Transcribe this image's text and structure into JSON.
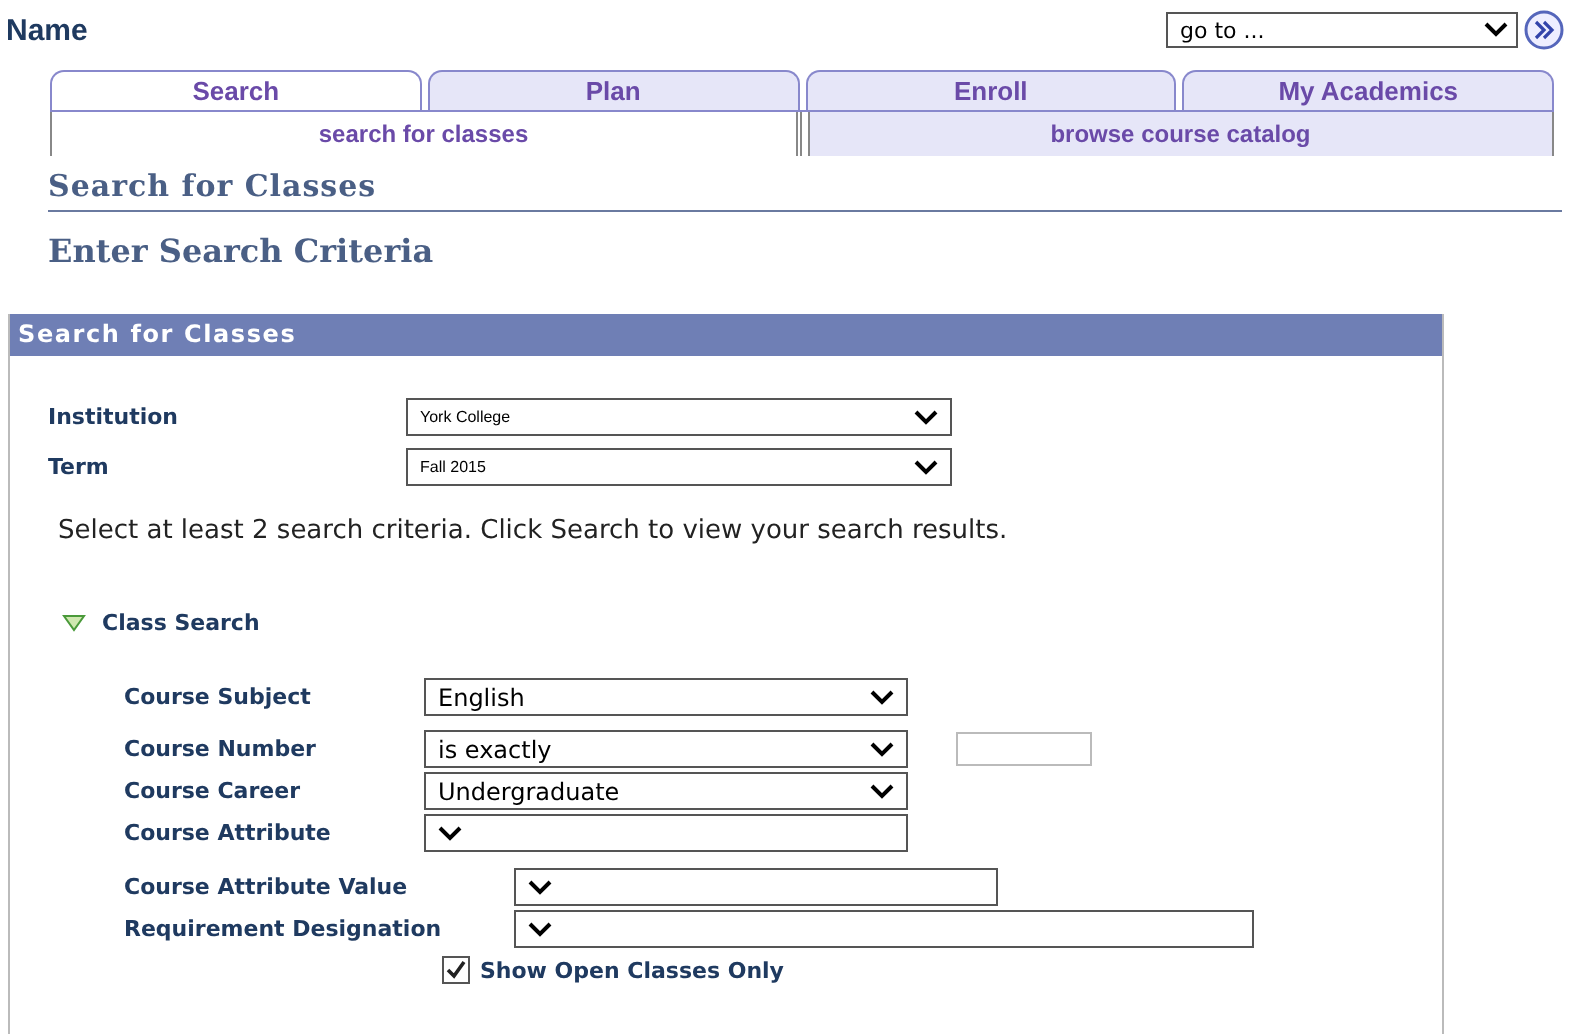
{
  "page_title": "Name",
  "goto": {
    "value": "go to ..."
  },
  "tabs": [
    {
      "label": "Search",
      "selected": true
    },
    {
      "label": "Plan",
      "selected": false
    },
    {
      "label": "Enroll",
      "selected": false
    },
    {
      "label": "My Academics",
      "selected": false
    }
  ],
  "subtabs": [
    {
      "label": "search for classes",
      "selected": true
    },
    {
      "label": "browse course catalog",
      "selected": false
    }
  ],
  "heading": "Search for Classes",
  "subheading": "Enter Search Criteria",
  "panel": {
    "title": "Search for Classes",
    "fields": [
      {
        "label": "Institution",
        "value": "York College"
      },
      {
        "label": "Term",
        "value": "Fall 2015"
      }
    ],
    "instructions": "Select at least 2 search criteria. Click Search to view your search results.",
    "section": {
      "title": "Class Search",
      "expanded": true,
      "criteria": [
        {
          "label": "Course Subject",
          "value": "English",
          "kind": "select"
        },
        {
          "label": "Course Number",
          "value": "is exactly",
          "kind": "select_text"
        },
        {
          "label": "Course Career",
          "value": "Undergraduate",
          "kind": "select"
        },
        {
          "label": "Course Attribute",
          "kind": "select"
        },
        {
          "label": "Course Attribute Value",
          "kind": "select"
        },
        {
          "label": "Requirement Designation",
          "kind": "select_long"
        }
      ],
      "open_only": {
        "label": "Show Open Classes Only",
        "checked": true
      }
    }
  }
}
